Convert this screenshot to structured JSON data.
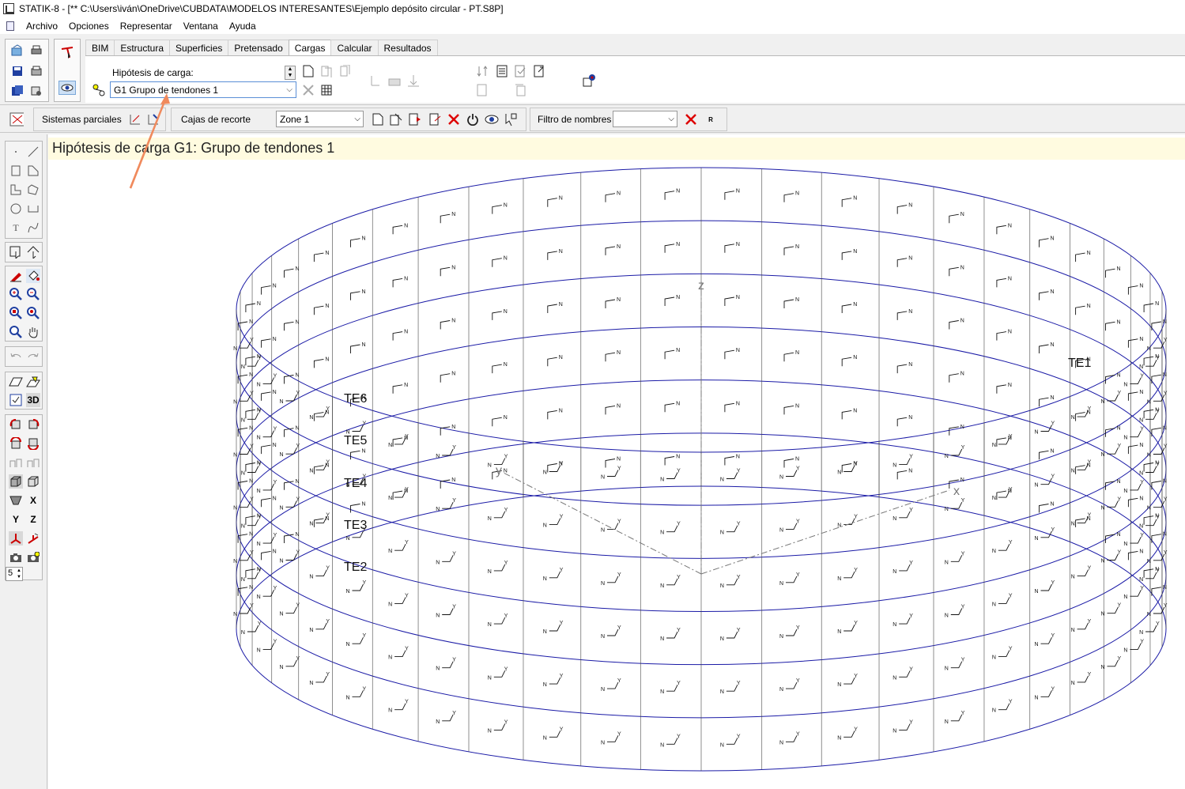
{
  "window": {
    "title": "STATIK-8 - [** C:\\Users\\iván\\OneDrive\\CUBDATA\\MODELOS INTERESANTES\\Ejemplo depósito circular - PT.S8P]"
  },
  "menu": [
    "Archivo",
    "Opciones",
    "Representar",
    "Ventana",
    "Ayuda"
  ],
  "tabs": [
    "BIM",
    "Estructura",
    "Superficies",
    "Pretensado",
    "Cargas",
    "Calcular",
    "Resultados"
  ],
  "active_tab": "Cargas",
  "load": {
    "label": "Hipótesis de carga:",
    "selected": "G1  Grupo de tendones 1",
    "banner": "Hipótesis de carga G1: Grupo de tendones 1"
  },
  "toolbar2": {
    "partial_systems": "Sistemas parciales",
    "clip_boxes": "Cajas de recorte",
    "zone_value": "Zone 1",
    "name_filter": "Filtro de nombres",
    "r_button": "R"
  },
  "left_toolbar": {
    "threed_label": "3D",
    "axis_x": "X",
    "axis_y": "Y",
    "axis_z": "Z",
    "number_value": "5"
  },
  "model": {
    "tendon_labels": [
      "TE1",
      "TE2",
      "TE3",
      "TE4",
      "TE5",
      "TE6"
    ],
    "axis_labels": {
      "x": "x",
      "y": "y",
      "z": "z"
    },
    "local_axis_letters": {
      "n": "N",
      "y": "Y"
    }
  },
  "colors": {
    "structure_line": "#1a1aa6",
    "annotation_arrow": "#f08a5d",
    "banner_bg": "#fffbe0"
  }
}
